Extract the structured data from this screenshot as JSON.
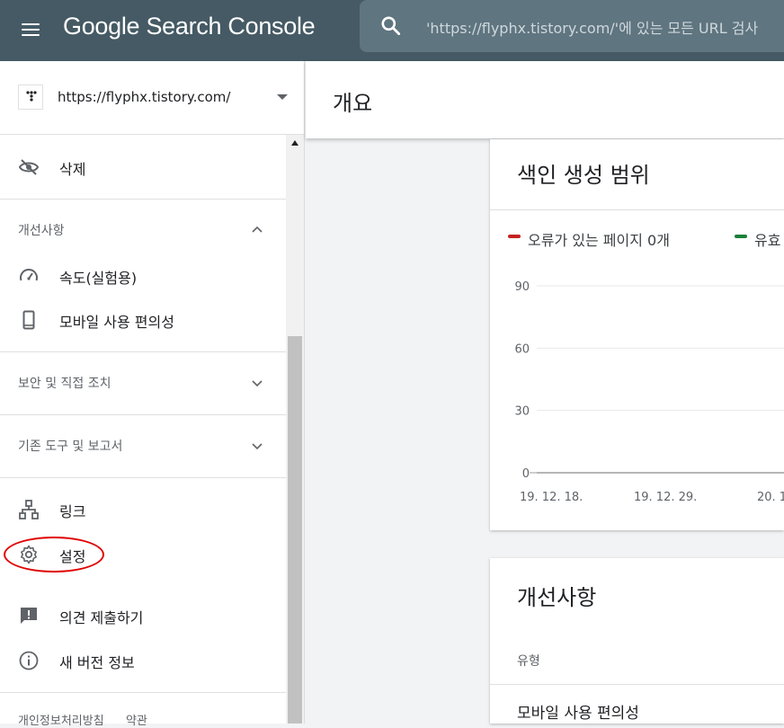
{
  "header": {
    "app_title": "Google Search Console",
    "search_placeholder": "'https://flyphx.tistory.com/'에 있는 모든 URL 검사"
  },
  "property": {
    "url": "https://flyphx.tistory.com/"
  },
  "sidebar": {
    "removals_label": "삭제",
    "enhancements": {
      "title": "개선사항",
      "items": [
        {
          "label": "속도(실험용)"
        },
        {
          "label": "모바일 사용 편의성"
        }
      ]
    },
    "security_label": "보안 및 직접 조치",
    "legacy_label": "기존 도구 및 보고서",
    "links_label": "링크",
    "settings_label": "설정",
    "feedback_label": "의견 제출하기",
    "whats_new_label": "새 버전 정보",
    "footer": {
      "privacy": "개인정보처리방침",
      "terms": "약관"
    }
  },
  "main": {
    "title": "개요",
    "coverage_card": {
      "title": "색인 생성 범위",
      "legend": [
        {
          "label": "오류가 있는 페이지 0개",
          "color": "#c5221f"
        },
        {
          "label": "유효",
          "color": "#188038"
        }
      ]
    },
    "enhancements_card": {
      "title": "개선사항",
      "column_header": "유형",
      "rows": [
        {
          "type": "모바일 사용 편의성"
        }
      ]
    }
  },
  "chart_data": {
    "type": "line",
    "title": "",
    "y_ticks": [
      90,
      60,
      30,
      0
    ],
    "ylim": [
      0,
      90
    ],
    "x_ticks": [
      "19. 12. 18.",
      "19. 12. 29.",
      "20. 1"
    ],
    "series": [
      {
        "name": "오류가 있는 페이지 0개",
        "color": "#c5221f",
        "values": [
          0,
          0,
          0
        ]
      }
    ],
    "grid": true
  },
  "colors": {
    "topbar": "#455a64",
    "search_box": "#5f7580",
    "annotation_circle": "#e00000"
  }
}
